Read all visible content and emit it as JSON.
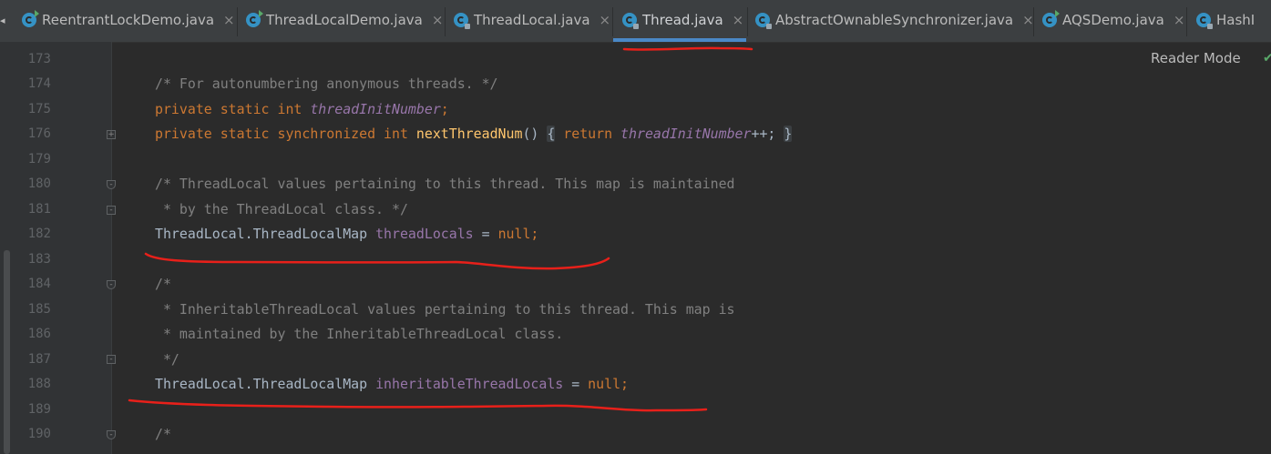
{
  "tabs": [
    {
      "label": "ReentrantLockDemo.java",
      "icon": "java-class-run-icon",
      "active": false
    },
    {
      "label": "ThreadLocalDemo.java",
      "icon": "java-class-run-icon",
      "active": false
    },
    {
      "label": "ThreadLocal.java",
      "icon": "java-class-locked-icon",
      "active": false
    },
    {
      "label": "Thread.java",
      "icon": "java-class-locked-icon",
      "active": true
    },
    {
      "label": "AbstractOwnableSynchronizer.java",
      "icon": "java-class-locked-icon",
      "active": false
    },
    {
      "label": "AQSDemo.java",
      "icon": "java-class-run-icon",
      "active": false
    },
    {
      "label": "HashI",
      "icon": "java-class-locked-icon",
      "active": false
    }
  ],
  "tab_close_glyph": "×",
  "reader_mode_label": "Reader Mode",
  "line_numbers": [
    "173",
    "174",
    "175",
    "176",
    "179",
    "180",
    "181",
    "182",
    "183",
    "184",
    "185",
    "186",
    "187",
    "188",
    "189",
    "190"
  ],
  "code": {
    "l174": "/* For autonumbering anonymous threads. */",
    "l175_kw": "private static int ",
    "l175_field": "threadInitNumber",
    "l175_end": ";",
    "l176_kw": "private static synchronized int ",
    "l176_fn": "nextThreadNum",
    "l176_paren": "() ",
    "l176_open": "{",
    "l176_ret": " return ",
    "l176_field": "threadInitNumber",
    "l176_end": "++; ",
    "l176_close": "}",
    "l180": "/* ThreadLocal values pertaining to this thread. This map is maintained",
    "l181": " * by the ThreadLocal class. */",
    "l182_type": "ThreadLocal.ThreadLocalMap ",
    "l182_field": "threadLocals",
    "l182_eq": " = ",
    "l182_null": "null;",
    "l184": "/*",
    "l185": " * InheritableThreadLocal values pertaining to this thread. This map is",
    "l186": " * maintained by the InheritableThreadLocal class.",
    "l187": " */",
    "l188_type": "ThreadLocal.ThreadLocalMap ",
    "l188_field": "inheritableThreadLocals",
    "l188_eq": " = ",
    "l188_null": "null;",
    "l190": "/*"
  },
  "colors": {
    "keyword": "#cc7832",
    "comment": "#808080",
    "field": "#9876aa",
    "function": "#ffc66d",
    "annotation_ink": "#e8201a",
    "active_tab_underline": "#4a88c7"
  }
}
